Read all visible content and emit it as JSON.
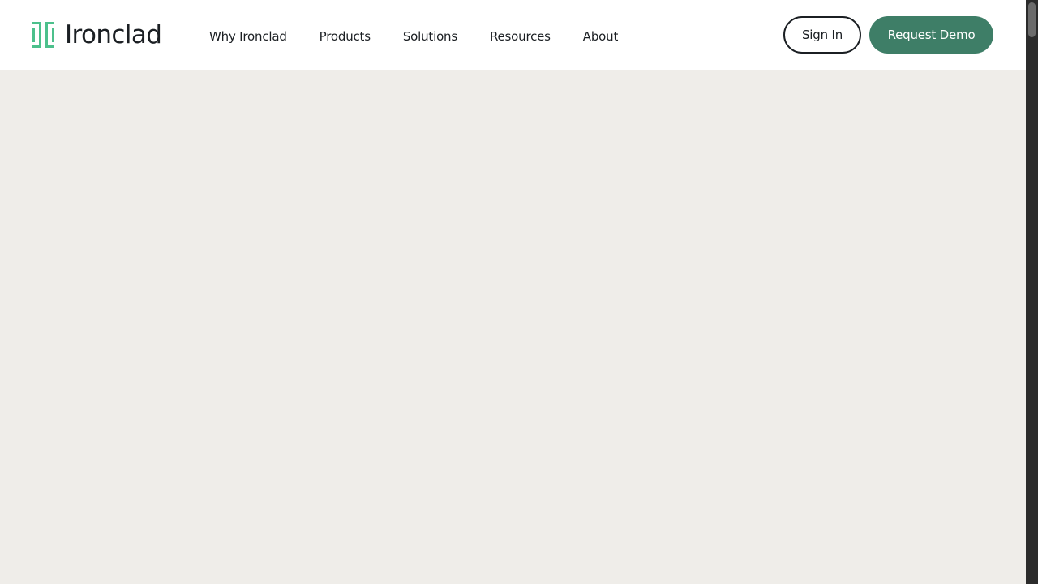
{
  "brand": {
    "name": "Ironclad",
    "icon": "ironclad-logo-icon",
    "accent_color": "#4cc08c"
  },
  "nav": {
    "items": [
      {
        "label": "Why Ironclad"
      },
      {
        "label": "Products"
      },
      {
        "label": "Solutions"
      },
      {
        "label": "Resources"
      },
      {
        "label": "About"
      }
    ]
  },
  "actions": {
    "sign_in_label": "Sign In",
    "request_demo_label": "Request Demo",
    "request_demo_color": "#3e7e67"
  },
  "colors": {
    "page_background": "#efede9",
    "header_background": "#ffffff",
    "text": "#1b1f23",
    "scrollbar_track": "#2b2b2b",
    "scrollbar_thumb": "#6b6b6b"
  }
}
